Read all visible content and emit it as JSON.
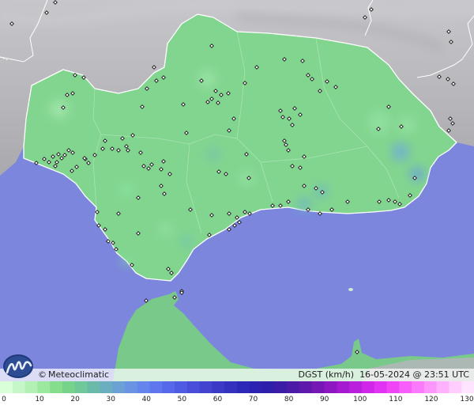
{
  "brand": {
    "copyright_symbol": "©",
    "name": "Meteoclimatic"
  },
  "parameter": {
    "label": "DGST (km/h)",
    "datetime": "16-05-2024 @ 23:51 UTC"
  },
  "colors": {
    "sea": "#7b86dc",
    "land_neighbor": "#b9b9bd",
    "land_main": "#82d58f",
    "land_africa": "#79c98a"
  },
  "scale": {
    "ticks": [
      "0",
      "10",
      "20",
      "30",
      "40",
      "50",
      "60",
      "70",
      "80",
      "90",
      "100",
      "110",
      "120",
      "130"
    ],
    "tick_values": [
      0,
      10,
      20,
      30,
      40,
      50,
      60,
      70,
      80,
      90,
      100,
      110,
      120,
      130
    ],
    "colors": [
      "#d8ffd8",
      "#c6f7c8",
      "#b2f0b4",
      "#9de89f",
      "#86dd8c",
      "#76d48a",
      "#6ec89a",
      "#6abaa9",
      "#6aaebf",
      "#6ba1d3",
      "#6a93e3",
      "#6585ec",
      "#5e77ee",
      "#5669ea",
      "#4f5be2",
      "#484ed9",
      "#4243cf",
      "#3b3ac6",
      "#3431bf",
      "#2d28b8",
      "#2b22b2",
      "#2e1faa",
      "#3a1ca6",
      "#4b1aa7",
      "#5e18ab",
      "#7517b5",
      "#8d17c3",
      "#a51ad1",
      "#bb1fde",
      "#d026ea",
      "#e232f3",
      "#ef45f7",
      "#f85efa",
      "#fb7afb",
      "#fd96fc",
      "#feb2fd",
      "#ffcdfe",
      "#ffe4ff"
    ]
  },
  "stations": [
    [
      15,
      30
    ],
    [
      59,
      16
    ],
    [
      70,
      3
    ],
    [
      95,
      95
    ],
    [
      106,
      98
    ],
    [
      85,
      120
    ],
    [
      92,
      118
    ],
    [
      80,
      136
    ],
    [
      198,
      102
    ],
    [
      207,
      98
    ],
    [
      186,
      112
    ],
    [
      195,
      85
    ],
    [
      268,
      58
    ],
    [
      255,
      102
    ],
    [
      273,
      115
    ],
    [
      268,
      125
    ],
    [
      276,
      130
    ],
    [
      280,
      120
    ],
    [
      289,
      118
    ],
    [
      263,
      129
    ],
    [
      232,
      132
    ],
    [
      236,
      168
    ],
    [
      180,
      135
    ],
    [
      168,
      171
    ],
    [
      155,
      175
    ],
    [
      160,
      185
    ],
    [
      150,
      190
    ],
    [
      142,
      188
    ],
    [
      162,
      190
    ],
    [
      178,
      193
    ],
    [
      130,
      188
    ],
    [
      120,
      196
    ],
    [
      108,
      201
    ],
    [
      87,
      190
    ],
    [
      82,
      196
    ],
    [
      74,
      195
    ],
    [
      78,
      200
    ],
    [
      72,
      205
    ],
    [
      70,
      210
    ],
    [
      62,
      205
    ],
    [
      46,
      206
    ],
    [
      56,
      201
    ],
    [
      97,
      211
    ],
    [
      91,
      216
    ],
    [
      112,
      206
    ],
    [
      182,
      210
    ],
    [
      188,
      213
    ],
    [
      192,
      208
    ],
    [
      207,
      204
    ],
    [
      204,
      214
    ],
    [
      215,
      220
    ],
    [
      208,
      245
    ],
    [
      204,
      235
    ],
    [
      175,
      250
    ],
    [
      150,
      270
    ],
    [
      123,
      268
    ],
    [
      125,
      285
    ],
    [
      133,
      290
    ],
    [
      137,
      305
    ],
    [
      143,
      307
    ],
    [
      147,
      315
    ],
    [
      167,
      335
    ],
    [
      175,
      295
    ],
    [
      213,
      340
    ],
    [
      217,
      345
    ],
    [
      230,
      368
    ],
    [
      185,
      380
    ],
    [
      241,
      265
    ],
    [
      268,
      272
    ],
    [
      265,
      297
    ],
    [
      290,
      270
    ],
    [
      290,
      290
    ],
    [
      297,
      285
    ],
    [
      303,
      281
    ],
    [
      310,
      268
    ],
    [
      316,
      270
    ],
    [
      300,
      275
    ],
    [
      286,
      220
    ],
    [
      290,
      165
    ],
    [
      296,
      150
    ],
    [
      312,
      195
    ],
    [
      315,
      225
    ],
    [
      277,
      217
    ],
    [
      310,
      105
    ],
    [
      325,
      85
    ],
    [
      360,
      75
    ],
    [
      383,
      77
    ],
    [
      395,
      100
    ],
    [
      405,
      115
    ],
    [
      414,
      103
    ],
    [
      425,
      110
    ],
    [
      390,
      95
    ],
    [
      373,
      137
    ],
    [
      355,
      140
    ],
    [
      358,
      148
    ],
    [
      366,
      150
    ],
    [
      370,
      158
    ],
    [
      380,
      145
    ],
    [
      360,
      178
    ],
    [
      362,
      183
    ],
    [
      365,
      190
    ],
    [
      370,
      210
    ],
    [
      380,
      212
    ],
    [
      385,
      198
    ],
    [
      385,
      235
    ],
    [
      400,
      238
    ],
    [
      408,
      243
    ],
    [
      390,
      265
    ],
    [
      405,
      270
    ],
    [
      420,
      265
    ],
    [
      440,
      255
    ],
    [
      480,
      255
    ],
    [
      492,
      253
    ],
    [
      500,
      255
    ],
    [
      506,
      258
    ],
    [
      519,
      247
    ],
    [
      525,
      225
    ],
    [
      492,
      135
    ],
    [
      508,
      160
    ],
    [
      479,
      163
    ],
    [
      345,
      260
    ],
    [
      355,
      260
    ],
    [
      365,
      255
    ],
    [
      462,
      22
    ],
    [
      470,
      12
    ],
    [
      568,
      40
    ],
    [
      571,
      53
    ],
    [
      556,
      97
    ],
    [
      567,
      100
    ],
    [
      574,
      106
    ],
    [
      570,
      150
    ],
    [
      573,
      156
    ],
    [
      568,
      165
    ],
    [
      452,
      445
    ],
    [
      221,
      376
    ],
    [
      230,
      370
    ],
    [
      133,
      178
    ],
    [
      107,
      200
    ],
    [
      92,
      193
    ],
    [
      67,
      198
    ]
  ]
}
